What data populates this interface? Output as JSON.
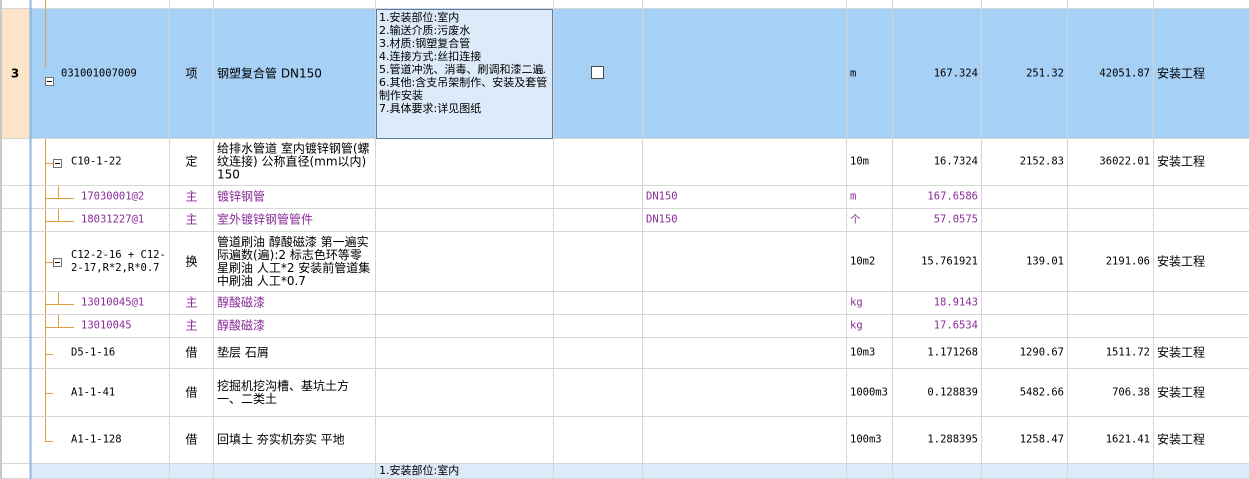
{
  "top_partial_row": {
    "text": ""
  },
  "main_item": {
    "row_number": "3",
    "code": "031001007009",
    "type": "项",
    "name": "钢塑复合管 DN150",
    "description": "1.安装部位:室内\n2.输送介质:污废水\n3.材质:钢塑复合管\n4.连接方式:丝扣连接\n5.管道冲洗、消毒、刷调和漆二遍\n6.其他:含支吊架制作、安装及套管制作安装\n7.具体要求:详见图纸",
    "ellipsis": "···",
    "unit": "m",
    "quantity": "167.324",
    "unit_price": "251.32",
    "total": "42051.87",
    "category": "安装工程"
  },
  "rows": [
    {
      "code": "C10-1-22",
      "type": "定",
      "name": "给排水管道 室内镀锌钢管(螺纹连接) 公称直径(mm以内) 150",
      "spec": "",
      "unit": "10m",
      "quantity": "16.7324",
      "unit_price": "2152.83",
      "total": "36022.01",
      "category": "安装工程",
      "purple": false,
      "expand": true
    },
    {
      "code": "17030001@2",
      "type": "主",
      "name": "镀锌钢管",
      "spec": "DN150",
      "unit": "m",
      "quantity": "167.6586",
      "unit_price": "",
      "total": "",
      "category": "",
      "purple": true,
      "expand": false
    },
    {
      "code": "18031227@1",
      "type": "主",
      "name": "室外镀锌钢管管件",
      "spec": "DN150",
      "unit": "个",
      "quantity": "57.0575",
      "unit_price": "",
      "total": "",
      "category": "",
      "purple": true,
      "expand": false
    },
    {
      "code": "C12-2-16 + C12-2-17,R*2,R*0.7",
      "type": "换",
      "name": "管道刷油 醇酸磁漆 第一遍实际遍数(遍):2  标志色环等零星刷油 人工*2  安装前管道集中刷油 人工*0.7",
      "spec": "",
      "unit": "10m2",
      "quantity": "15.761921",
      "unit_price": "139.01",
      "total": "2191.06",
      "category": "安装工程",
      "purple": false,
      "expand": true
    },
    {
      "code": "13010045@1",
      "type": "主",
      "name": "醇酸磁漆",
      "spec": "",
      "unit": "kg",
      "quantity": "18.9143",
      "unit_price": "",
      "total": "",
      "category": "",
      "purple": true,
      "expand": false
    },
    {
      "code": "13010045",
      "type": "主",
      "name": "醇酸磁漆",
      "spec": "",
      "unit": "kg",
      "quantity": "17.6534",
      "unit_price": "",
      "total": "",
      "category": "",
      "purple": true,
      "expand": false
    },
    {
      "code": "D5-1-16",
      "type": "借",
      "name": "垫层 石屑",
      "spec": "",
      "unit": "10m3",
      "quantity": "1.171268",
      "unit_price": "1290.67",
      "total": "1511.72",
      "category": "安装工程",
      "purple": false,
      "expand": false
    },
    {
      "code": "A1-1-41",
      "type": "借",
      "name": "挖掘机挖沟槽、基坑土方 一、二类土",
      "spec": "",
      "unit": "1000m3",
      "quantity": "0.128839",
      "unit_price": "5482.66",
      "total": "706.38",
      "category": "安装工程",
      "purple": false,
      "expand": false
    },
    {
      "code": "A1-1-128",
      "type": "借",
      "name": "回填土 夯实机夯实 平地",
      "spec": "",
      "unit": "100m3",
      "quantity": "1.288395",
      "unit_price": "1258.47",
      "total": "1621.41",
      "category": "安装工程",
      "purple": false,
      "expand": false
    }
  ],
  "next_item": {
    "description_first_line": "1.安装部位:室内"
  },
  "colors": {
    "selected_row": "#a7d0f7",
    "row_number_bg": "#fbe4c8",
    "main_material_text": "#8b2b9a",
    "tree_line": "#e0a040"
  }
}
